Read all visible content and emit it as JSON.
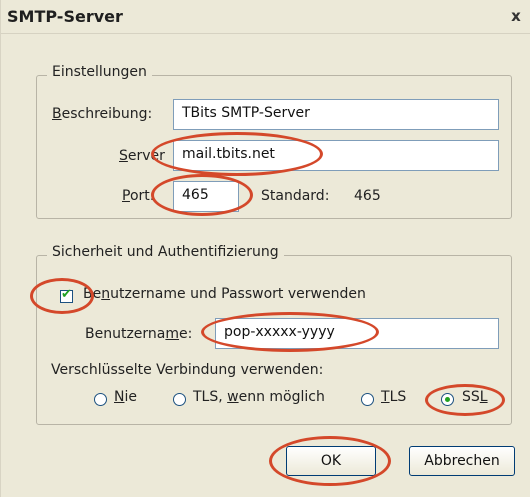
{
  "window": {
    "title": "SMTP-Server",
    "close_glyph": "x"
  },
  "settings_group": {
    "legend": "Einstellungen",
    "description_label_pre": "",
    "description_label_u": "B",
    "description_label_post": "eschreibung:",
    "description_value": "TBits SMTP-Server",
    "server_label_pre": "",
    "server_label_u": "S",
    "server_label_post": "erver",
    "server_value": "mail.tbits.net",
    "port_label_pre": "",
    "port_label_u": "P",
    "port_label_post": "ort:",
    "port_value": "465",
    "standard_label": "Standard:",
    "standard_value": "465"
  },
  "security_group": {
    "legend": "Sicherheit und Authentifizierung",
    "use_auth_pre": "Be",
    "use_auth_u": "n",
    "use_auth_post": "utzername und Passwort verwenden",
    "use_auth_checked": true,
    "username_label_pre": "Benutzerna",
    "username_label_u": "m",
    "username_label_post": "e:",
    "username_value": "pop-xxxxx-yyyy",
    "encryption_label": "Verschlüsselte Verbindung verwenden:",
    "options": [
      {
        "pre": "",
        "u": "N",
        "post": "ie",
        "selected": false
      },
      {
        "pre": "TLS, ",
        "u": "w",
        "post": "enn möglich",
        "selected": false
      },
      {
        "pre": "",
        "u": "T",
        "post": "LS",
        "selected": false
      },
      {
        "pre": "SS",
        "u": "L",
        "post": "",
        "selected": true
      }
    ]
  },
  "buttons": {
    "ok": "OK",
    "cancel": "Abbrechen"
  },
  "colors": {
    "annotation": "#d4482a",
    "background": "#ece9d8",
    "field_border": "#7f9db9"
  }
}
